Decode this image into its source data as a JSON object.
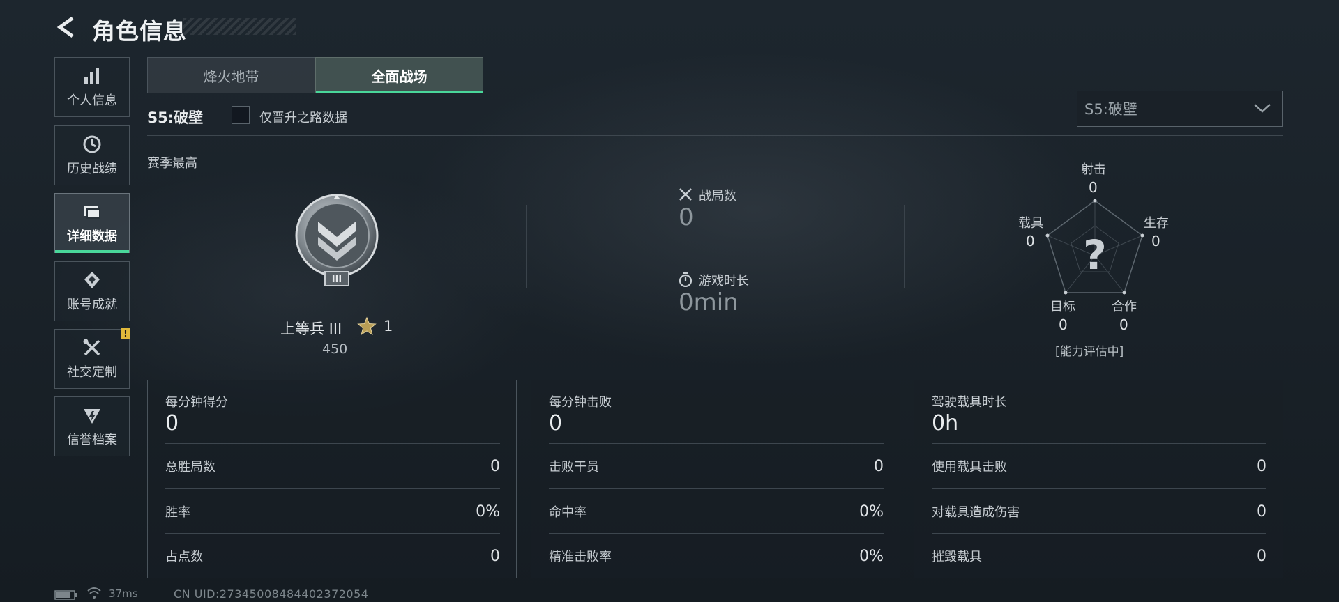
{
  "header": {
    "title": "角色信息"
  },
  "sidebar": {
    "items": [
      {
        "label": "个人信息",
        "icon": "bar-chart-icon"
      },
      {
        "label": "历史战绩",
        "icon": "clock-history-icon"
      },
      {
        "label": "详细数据",
        "icon": "folder-icon",
        "active": true
      },
      {
        "label": "账号成就",
        "icon": "achievement-icon"
      },
      {
        "label": "社交定制",
        "icon": "tools-icon",
        "badge": "!"
      },
      {
        "label": "信誉档案",
        "icon": "shield-icon"
      }
    ]
  },
  "tabs": [
    {
      "label": "烽火地带"
    },
    {
      "label": "全面战场",
      "active": true
    }
  ],
  "filter": {
    "season_label": "S5:破壁",
    "checkbox_label": "仅晋升之路数据",
    "dropdown_value": "S5:破壁"
  },
  "season_best": {
    "title": "赛季最高",
    "rank_name": "上等兵 III",
    "stars": "1",
    "points": "450"
  },
  "center_stats": {
    "matches_label": "战局数",
    "matches_value": "0",
    "playtime_label": "游戏时长",
    "playtime_value": "0min"
  },
  "radar": {
    "shoot_label": "射击",
    "shoot_value": "0",
    "survive_label": "生存",
    "survive_value": "0",
    "coop_label": "合作",
    "coop_value": "0",
    "objective_label": "目标",
    "objective_value": "0",
    "vehicle_label": "载具",
    "vehicle_value": "0",
    "center_mark": "?",
    "status": "[能力评估中]"
  },
  "panels": [
    {
      "title": "每分钟得分",
      "value": "0",
      "rows": [
        {
          "k": "总胜局数",
          "v": "0"
        },
        {
          "k": "胜率",
          "v": "0%"
        },
        {
          "k": "占点数",
          "v": "0"
        }
      ]
    },
    {
      "title": "每分钟击败",
      "value": "0",
      "rows": [
        {
          "k": "击败干员",
          "v": "0"
        },
        {
          "k": "命中率",
          "v": "0%"
        },
        {
          "k": "精准击败率",
          "v": "0%"
        }
      ]
    },
    {
      "title": "驾驶载具时长",
      "value": "0h",
      "rows": [
        {
          "k": "使用载具击败",
          "v": "0"
        },
        {
          "k": "对载具造成伤害",
          "v": "0"
        },
        {
          "k": "摧毁载具",
          "v": "0"
        }
      ]
    }
  ],
  "footer": {
    "ping": "37ms",
    "uid": "CN UID:27345008484402372054"
  },
  "colors": {
    "accent": "#49d79a",
    "badge": "#e0b93b"
  }
}
